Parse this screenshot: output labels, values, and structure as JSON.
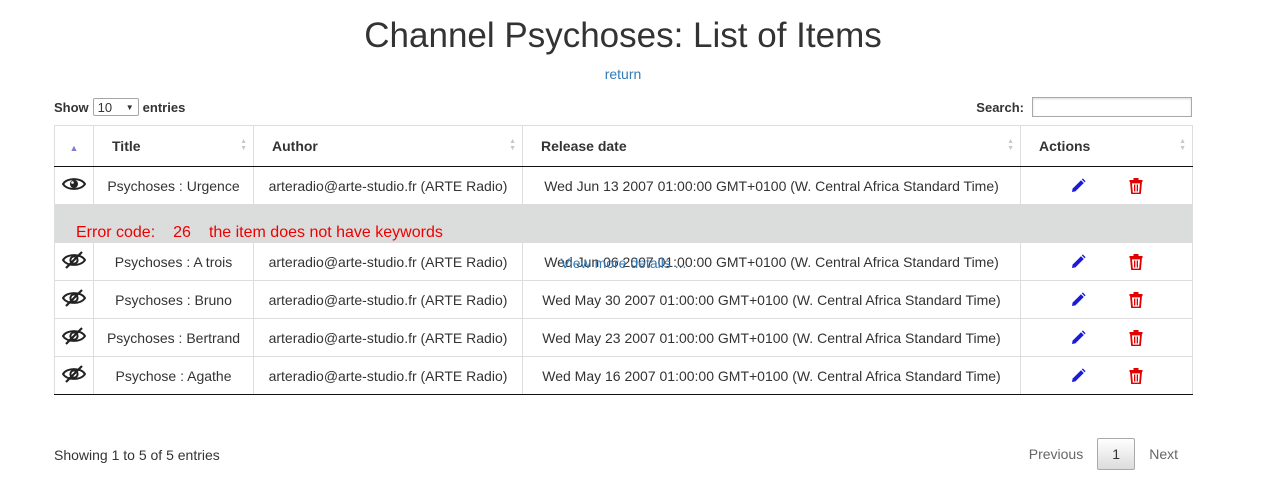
{
  "page": {
    "title": "Channel Psychoses: List of Items",
    "return_label": "return"
  },
  "controls": {
    "show_label": "Show",
    "page_length": "10",
    "entries_label": "entries",
    "search_label": "Search:",
    "search_value": ""
  },
  "table": {
    "columns": [
      "",
      "Title",
      "Author",
      "Release date",
      "Actions"
    ],
    "rows": [
      {
        "visibility_icon": "eye-icon",
        "title": "Psychoses : Urgence",
        "author": "arteradio@arte-studio.fr (ARTE Radio)",
        "release_date": "Wed Jun 13 2007 01:00:00 GMT+0100 (W. Central Africa Standard Time)"
      },
      {
        "visibility_icon": "eye-slash-icon",
        "title": "Psychoses : A trois",
        "author": "arteradio@arte-studio.fr (ARTE Radio)",
        "release_date": "Wed Jun 06 2007 01:00:00 GMT+0100 (W. Central Africa Standard Time)"
      },
      {
        "visibility_icon": "eye-slash-icon",
        "title": "Psychoses : Bruno",
        "author": "arteradio@arte-studio.fr (ARTE Radio)",
        "release_date": "Wed May 30 2007 01:00:00 GMT+0100 (W. Central Africa Standard Time)"
      },
      {
        "visibility_icon": "eye-slash-icon",
        "title": "Psychoses : Bertrand",
        "author": "arteradio@arte-studio.fr (ARTE Radio)",
        "release_date": "Wed May 23 2007 01:00:00 GMT+0100 (W. Central Africa Standard Time)"
      },
      {
        "visibility_icon": "eye-slash-icon",
        "title": "Psychose : Agathe",
        "author": "arteradio@arte-studio.fr (ARTE Radio)",
        "release_date": "Wed May 16 2007 01:00:00 GMT+0100 (W. Central Africa Standard Time)"
      }
    ],
    "error": {
      "label": "Error code:",
      "code": "26",
      "message": "the item does not have keywords",
      "details_link": "View more details ..."
    }
  },
  "footer": {
    "info": "Showing 1 to 5 of 5 entries",
    "previous_label": "Previous",
    "current_page": "1",
    "next_label": "Next"
  },
  "colors": {
    "link": "#337ab7",
    "error_text": "#ee0000",
    "error_bg": "#dbdcdc",
    "edit_icon": "#1a1adb",
    "delete_icon": "#e00000"
  }
}
